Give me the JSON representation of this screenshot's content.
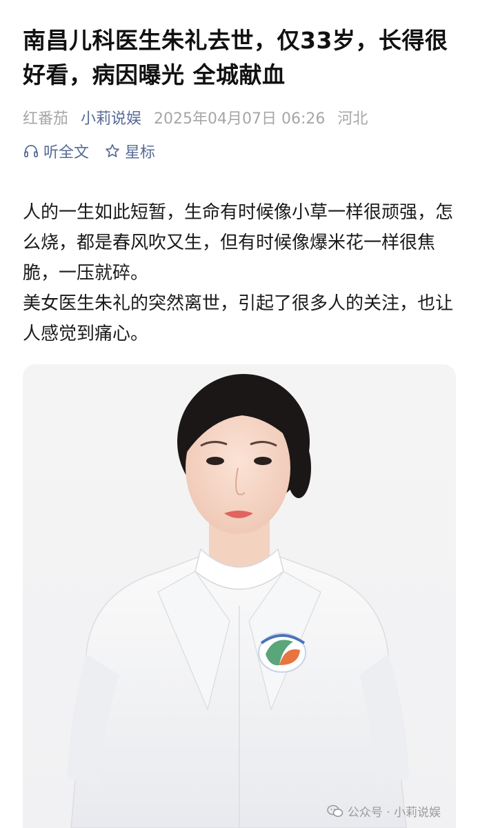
{
  "article": {
    "title": "南昌儿科医生朱礼去世，仅33岁，长得很好看，病因曝光 全城献血",
    "meta": {
      "source": "红番茄",
      "account": "小莉说娱",
      "date": "2025年04月07日 06:26",
      "location": "河北"
    },
    "actions": {
      "listen": "听全文",
      "star": "星标"
    },
    "paragraphs": [
      "人的一生如此短暂，生命有时候像小草一样很顽强，怎么烧，都是春风吹又生，但有时候像爆米花一样很焦脆，一压就碎。",
      "美女医生朱礼的突然离世，引起了很多人的关注，也让人感觉到痛心。"
    ],
    "image": {
      "watermark": "公众号 · 小莉说娱"
    }
  }
}
